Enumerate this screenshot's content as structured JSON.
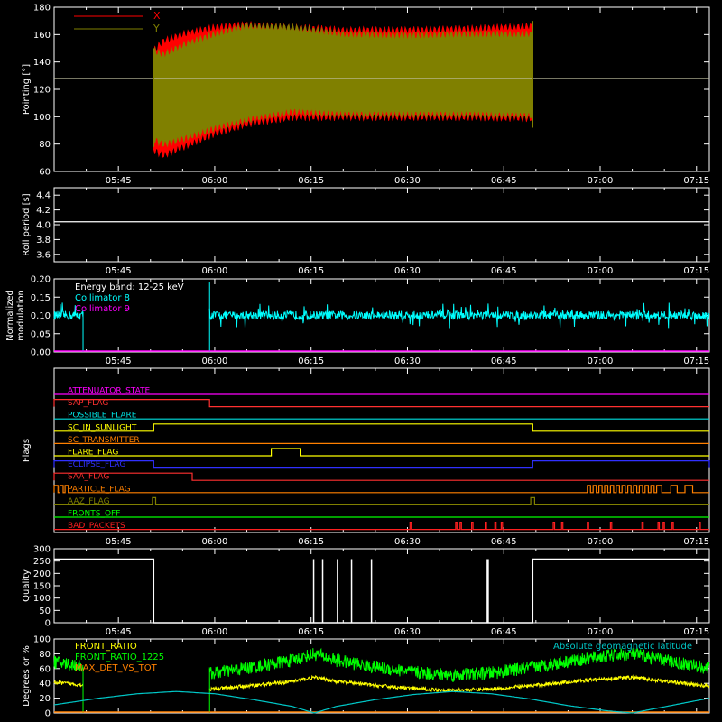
{
  "colors": {
    "background": "#000000",
    "axis": "#ffffff",
    "x_series": "#ff0000",
    "y_series": "#808000",
    "collimator8": "#00ffff",
    "collimator9": "#ff00ff",
    "front_ratio": "#ffff00",
    "front_ratio_1225": "#00ff00",
    "max_det": "#ff8000",
    "latitude": "#00c8c8"
  },
  "time_axis": {
    "start_min": 335,
    "end_min": 437,
    "tick_labels": [
      "05:45",
      "06:00",
      "06:15",
      "06:30",
      "06:45",
      "07:00",
      "07:15"
    ]
  },
  "chart_data": [
    {
      "type": "area",
      "ylabel": "Pointing [°]",
      "ylim": [
        60,
        180
      ],
      "yticks": [
        "60",
        "80",
        "100",
        "120",
        "140",
        "160",
        "180"
      ],
      "reference_line_y": 128,
      "data_window_min": [
        350.5,
        409.5
      ],
      "series": [
        {
          "name": "X",
          "envelope_time_min": [
            350.5,
            352,
            355,
            360,
            365,
            372,
            380,
            390,
            400,
            409.5
          ],
          "upper": [
            148,
            155,
            160,
            165,
            167,
            165,
            163,
            163,
            164,
            166
          ],
          "lower": [
            76,
            72,
            78,
            88,
            95,
            100,
            100,
            100,
            100,
            99
          ]
        },
        {
          "name": "Y",
          "envelope_time_min": [
            350.5,
            352,
            355,
            360,
            365,
            372,
            380,
            390,
            400,
            409.5
          ],
          "upper": [
            148,
            145,
            152,
            160,
            166,
            165,
            160,
            159,
            160,
            160
          ],
          "lower": [
            84,
            80,
            84,
            92,
            98,
            104,
            102,
            102,
            102,
            101
          ]
        }
      ]
    },
    {
      "type": "line",
      "ylabel": "Roll period [s]",
      "ylim": [
        3.5,
        4.5
      ],
      "yticks": [
        "3.6",
        "3.8",
        "4.0",
        "4.2",
        "4.4"
      ],
      "series": [
        {
          "values_constant": 4.04
        }
      ]
    },
    {
      "type": "line",
      "ylabel": "Normalized modulation",
      "ylabel_lines": [
        "Normalized",
        "modulation"
      ],
      "ylim": [
        0,
        0.2
      ],
      "yticks": [
        "0.00",
        "0.05",
        "0.10",
        "0.15",
        "0.20"
      ],
      "legend_title": "Energy band: 12-25 keV",
      "series": [
        {
          "name": "Collimator 8",
          "segments_min": [
            [
              335,
              339.5
            ],
            [
              359.2,
              437
            ]
          ],
          "mean": 0.1,
          "noise": 0.012
        },
        {
          "name": "Collimator 9",
          "values_constant": 0.0
        }
      ]
    },
    {
      "type": "table",
      "ylabel": "Flags",
      "flags": [
        {
          "name": "ATTENUATOR_STATE",
          "color": "#ff00ff",
          "on": []
        },
        {
          "name": "SAP_FLAG",
          "color": "#ff3030",
          "on": [
            [
              335,
              359.2
            ]
          ]
        },
        {
          "name": "POSSIBLE_FLARE",
          "color": "#00e0e0",
          "on": []
        },
        {
          "name": "SC_IN_SUNLIGHT",
          "color": "#ffff00",
          "on": [
            [
              350.5,
              409.5
            ]
          ]
        },
        {
          "name": "SC_TRANSMITTER",
          "color": "#ff8000",
          "on": []
        },
        {
          "name": "FLARE_FLAG",
          "color": "#ffff00",
          "on": [
            [
              368.8,
              373.3
            ]
          ]
        },
        {
          "name": "ECLIPSE_FLAG",
          "color": "#3030ff",
          "on": [
            [
              335,
              350.5
            ],
            [
              409.5,
              437
            ]
          ]
        },
        {
          "name": "SAA_FLAG",
          "color": "#ff3030",
          "on": [
            [
              335,
              356.5
            ]
          ]
        },
        {
          "name": "PARTICLE_FLAG",
          "color": "#ff8000",
          "on": [
            [
              335,
              335.6
            ],
            [
              335.9,
              336.4
            ],
            [
              336.7,
              337.2
            ],
            [
              418,
              418.5
            ],
            [
              418.9,
              419.4
            ],
            [
              419.8,
              420.3
            ],
            [
              420.7,
              421.2
            ],
            [
              421.6,
              422.1
            ],
            [
              422.5,
              423
            ],
            [
              423.4,
              423.9
            ],
            [
              424.3,
              424.8
            ],
            [
              425.2,
              425.7
            ],
            [
              426.1,
              426.6
            ],
            [
              427,
              427.5
            ],
            [
              427.9,
              428.4
            ],
            [
              428.8,
              429.6
            ],
            [
              431,
              432
            ],
            [
              433.2,
              434.4
            ]
          ]
        },
        {
          "name": "AAZ_FLAG",
          "color": "#808000",
          "on": [
            [
              350.3,
              350.8
            ],
            [
              409.2,
              409.8
            ]
          ]
        },
        {
          "name": "FRONTS_OFF",
          "color": "#00ff00",
          "on": []
        },
        {
          "name": "BAD_PACKETS",
          "color": "#ff2020",
          "on": [
            [
              390.4,
              390.6
            ],
            [
              397.5,
              397.7
            ],
            [
              398.2,
              398.4
            ],
            [
              400,
              400.2
            ],
            [
              402.1,
              402.3
            ],
            [
              403.6,
              403.8
            ],
            [
              404.6,
              404.8
            ],
            [
              412.7,
              412.9
            ],
            [
              414,
              414.2
            ],
            [
              418,
              418.2
            ],
            [
              421.6,
              421.8
            ],
            [
              426.5,
              426.7
            ],
            [
              429,
              429.2
            ],
            [
              429.8,
              430
            ],
            [
              431.2,
              431.4
            ],
            [
              435.4,
              435.6
            ]
          ]
        }
      ]
    },
    {
      "type": "line",
      "ylabel": "Quality",
      "ylim": [
        0,
        300
      ],
      "yticks": [
        "0",
        "50",
        "100",
        "150",
        "200",
        "250",
        "300"
      ],
      "series": [
        {
          "steps": [
            [
              335,
              350.5,
              258
            ],
            [
              350.5,
              409.5,
              0
            ],
            [
              409.5,
              437,
              258
            ]
          ],
          "spikes_min": [
            375.4,
            376.8,
            379.1,
            381.3,
            384.4,
            402.5
          ]
        }
      ]
    },
    {
      "type": "line",
      "ylabel": "Degrees or %",
      "ylim": [
        0,
        100
      ],
      "yticks": [
        "0",
        "20",
        "40",
        "60",
        "80",
        "100"
      ],
      "annotation": "Absolute geomagnetic latitude",
      "series": [
        {
          "name": "FRONT_RATIO",
          "segments_min": [
            [
              335,
              339.5
            ],
            [
              359.2,
              437
            ]
          ],
          "base": 30
        },
        {
          "name": "FRONT_RATIO_1225",
          "segments_min": [
            [
              335,
              339.5
            ],
            [
              359.2,
              437
            ]
          ],
          "base": 50
        },
        {
          "name": "MAX_DET_VS_TOT",
          "values_constant": 0
        },
        {
          "name": "",
          "latitude_min_points": [
            [
              335,
              11
            ],
            [
              342,
              20
            ],
            [
              348,
              26
            ],
            [
              354,
              29
            ],
            [
              360,
              26
            ],
            [
              366,
              18
            ],
            [
              372,
              9
            ],
            [
              375.5,
              0
            ],
            [
              379,
              9
            ],
            [
              385,
              18
            ],
            [
              391,
              25
            ],
            [
              397,
              29
            ],
            [
              403,
              26
            ],
            [
              409,
              19
            ],
            [
              415,
              10
            ],
            [
              421,
              3
            ],
            [
              425,
              0
            ],
            [
              431,
              10
            ],
            [
              437,
              20
            ]
          ]
        }
      ]
    }
  ]
}
